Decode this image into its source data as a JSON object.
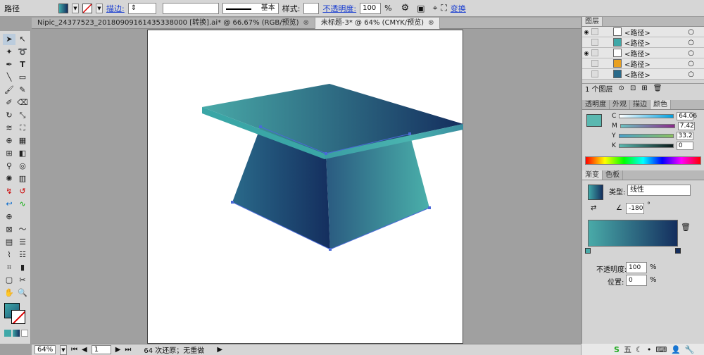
{
  "control_bar": {
    "object_type": "路径",
    "stroke_label": "描边:",
    "stroke_profile": "基本",
    "style_label": "样式:",
    "opacity_label": "不透明度:",
    "opacity_value": "100",
    "opacity_unit": "%",
    "transform_link": "变换"
  },
  "doc_tabs": [
    {
      "label": "Nipic_24377523_20180909161435338000 [转换].ai* @ 66.67% (RGB/预览)",
      "close": "⊗"
    },
    {
      "label": "未标题-3* @ 64% (CMYK/预览)",
      "close": "⊗"
    }
  ],
  "status": {
    "zoom": "64%",
    "page": "1",
    "message": "64 次还原；无重做"
  },
  "layers_panel": {
    "title": "图层",
    "rows": [
      "<路径>",
      "<路径>",
      "<路径>",
      "<路径>",
      "<路径>"
    ],
    "footer": "1 个图层"
  },
  "color_panel": {
    "tabs": [
      "透明度",
      "外观",
      "描边",
      "颜色"
    ],
    "channels": [
      {
        "name": "C",
        "value": "64.06"
      },
      {
        "name": "M",
        "value": "7.42"
      },
      {
        "name": "Y",
        "value": "33.2"
      },
      {
        "name": "K",
        "value": "0"
      }
    ]
  },
  "gradient_panel": {
    "tabs": [
      "渐变",
      "色板"
    ],
    "type_label": "类型:",
    "type_value": "线性",
    "angle_value": "-180",
    "angle_unit": "°",
    "opacity_label": "不透明度:",
    "opacity_value": "100",
    "opacity_unit": "%",
    "position_label": "位置:",
    "position_value": "0",
    "position_unit": "%"
  },
  "taskbar": {
    "ime": "五"
  },
  "colors": {
    "teal": "#3fa8a8",
    "navy": "#142e5e",
    "accent_blue": "#1b3fd0"
  }
}
